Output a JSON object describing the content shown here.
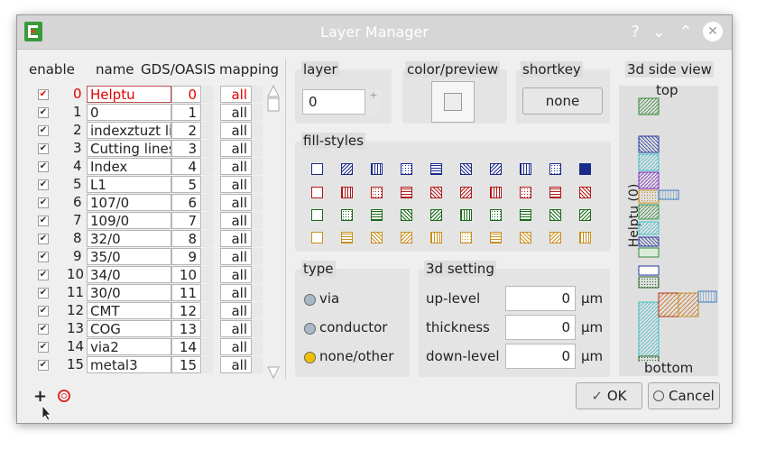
{
  "window": {
    "title": "Layer Manager",
    "help_glyph": "?",
    "minimize_glyph": "⌄",
    "maximize_glyph": "⌃",
    "close_glyph": "✕"
  },
  "columns": {
    "enable": "enable",
    "name": "name",
    "gds": "GDS/OASIS",
    "mapping": "mapping"
  },
  "layers": [
    {
      "index": "0",
      "name": "Helptu",
      "gds": "0",
      "mapping": "all",
      "selected": true
    },
    {
      "index": "1",
      "name": "0",
      "gds": "1",
      "mapping": "all"
    },
    {
      "index": "2",
      "name": "indexztuzt li",
      "gds": "2",
      "mapping": "all"
    },
    {
      "index": "3",
      "name": "Cutting lines",
      "gds": "3",
      "mapping": "all"
    },
    {
      "index": "4",
      "name": "Index",
      "gds": "4",
      "mapping": "all"
    },
    {
      "index": "5",
      "name": "L1",
      "gds": "5",
      "mapping": "all"
    },
    {
      "index": "6",
      "name": "107/0",
      "gds": "6",
      "mapping": "all"
    },
    {
      "index": "7",
      "name": "109/0",
      "gds": "7",
      "mapping": "all"
    },
    {
      "index": "8",
      "name": "32/0",
      "gds": "8",
      "mapping": "all"
    },
    {
      "index": "9",
      "name": "35/0",
      "gds": "9",
      "mapping": "all"
    },
    {
      "index": "10",
      "name": "34/0",
      "gds": "10",
      "mapping": "all"
    },
    {
      "index": "11",
      "name": "30/0",
      "gds": "11",
      "mapping": "all"
    },
    {
      "index": "12",
      "name": "CMT",
      "gds": "12",
      "mapping": "all"
    },
    {
      "index": "13",
      "name": "COG",
      "gds": "13",
      "mapping": "all"
    },
    {
      "index": "14",
      "name": "via2",
      "gds": "14",
      "mapping": "all"
    },
    {
      "index": "15",
      "name": "metal3",
      "gds": "15",
      "mapping": "all"
    }
  ],
  "layer_panel": {
    "title": "layer",
    "value": "0",
    "spin_glyph": "+"
  },
  "color_panel": {
    "title": "color/preview"
  },
  "shortkey_panel": {
    "title": "shortkey",
    "button": "none"
  },
  "fill_panel": {
    "title": "fill-styles"
  },
  "type_panel": {
    "title": "type",
    "options": [
      "via",
      "conductor",
      "none/other"
    ],
    "selected": "none/other"
  },
  "setting_panel": {
    "title": "3d setting",
    "rows": [
      {
        "label": "up-level",
        "value": "0",
        "unit": "µm"
      },
      {
        "label": "thickness",
        "value": "0",
        "unit": "µm"
      },
      {
        "label": "down-level",
        "value": "0",
        "unit": "µm"
      }
    ]
  },
  "side_view": {
    "title": "3d side view",
    "top": "top",
    "bottom": "bottom",
    "layer_label": "Helptu (0)"
  },
  "footer": {
    "add_glyph": "+",
    "ok": "OK",
    "ok_glyph": "✓",
    "cancel": "Cancel",
    "cancel_glyph": "⃠"
  },
  "colors": {
    "selected_text": "#e00000",
    "fill_blue": "#1a2a8a",
    "fill_red": "#b01818",
    "fill_green": "#1a6a1a",
    "fill_orange": "#c89020",
    "radio_via": "#a8b8c8",
    "radio_selected": "#f0c000"
  }
}
